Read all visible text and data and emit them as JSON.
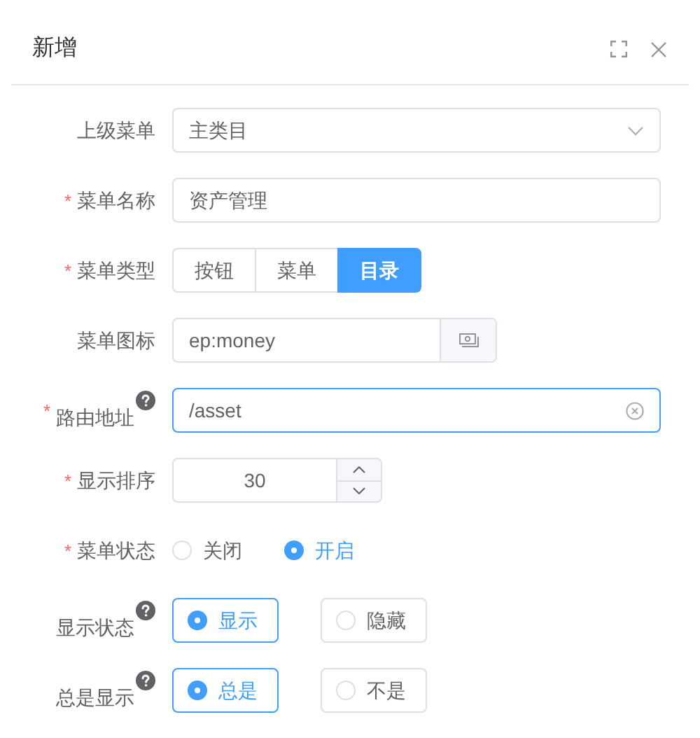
{
  "dialog": {
    "title": "新增"
  },
  "fields": [
    {
      "kind": "select",
      "label": "上级菜单",
      "value": "主类目"
    },
    {
      "kind": "text",
      "required_mark": "*",
      "label": "菜单名称",
      "focused": false,
      "value": "资产管理"
    },
    {
      "kind": "segmented",
      "required_mark": "*",
      "label": "菜单类型",
      "options": [
        {
          "label": "按钮",
          "selected": false
        },
        {
          "label": "菜单",
          "selected": false
        },
        {
          "label": "目录",
          "selected": true
        }
      ]
    },
    {
      "kind": "icon-picker",
      "label": "菜单图标",
      "value": "ep:money"
    },
    {
      "kind": "text",
      "required_mark": "*",
      "label": "路由地址",
      "help": true,
      "focused": true,
      "clearable": true,
      "value": "/asset"
    },
    {
      "kind": "number",
      "required_mark": "*",
      "label": "显示排序",
      "value": "30"
    },
    {
      "kind": "radio",
      "required_mark": "*",
      "label": "菜单状态",
      "options": [
        {
          "label": "关闭",
          "selected": false
        },
        {
          "label": "开启",
          "selected": true
        }
      ]
    },
    {
      "kind": "radio-bordered",
      "label": "显示状态",
      "help": true,
      "options": [
        {
          "label": "显示",
          "selected": true
        },
        {
          "label": "隐藏",
          "selected": false
        }
      ]
    },
    {
      "kind": "radio-bordered",
      "label": "总是显示",
      "help": true,
      "options": [
        {
          "label": "总是",
          "selected": true
        },
        {
          "label": "不是",
          "selected": false
        }
      ]
    }
  ]
}
